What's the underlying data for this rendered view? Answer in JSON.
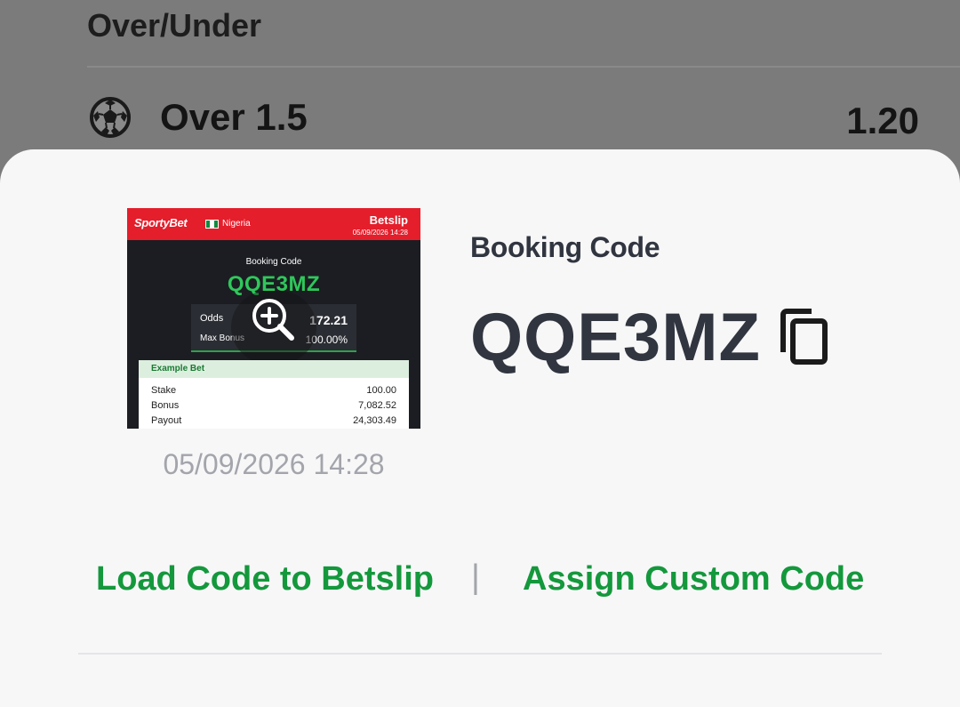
{
  "background": {
    "market_title": "Over/Under",
    "outcome": {
      "label": "Over 1.5",
      "odds": "1.20",
      "icon": "soccer-ball-icon"
    }
  },
  "sheet": {
    "thumbnail": {
      "brand": "SportyBet",
      "country": "Nigeria",
      "slip_title": "Betslip",
      "slip_date": "05/09/2026 14:28",
      "booking_label": "Booking Code",
      "code": "QQE3MZ",
      "odds_label": "Odds",
      "odds_value": "172.21",
      "max_bonus_label": "Max Bonus",
      "max_bonus_value": "100.00%",
      "example_title": "Example Bet",
      "rows": [
        {
          "label": "Stake",
          "value": "100.00"
        },
        {
          "label": "Bonus",
          "value": "7,082.52"
        },
        {
          "label": "Payout",
          "value": "24,303.49"
        }
      ],
      "zoom_icon": "zoom-in-icon"
    },
    "timestamp": "05/09/2026 14:28",
    "booking_code_label": "Booking Code",
    "booking_code": "QQE3MZ",
    "copy_icon": "copy-icon",
    "actions": {
      "load": "Load Code to Betslip",
      "separator": "|",
      "assign": "Assign Custom Code"
    }
  },
  "colors": {
    "accent_green": "#14983c",
    "brand_red": "#e41e2b",
    "code_green": "#2fc75b",
    "text_dark": "#30353f",
    "muted": "#a3a5ab"
  }
}
